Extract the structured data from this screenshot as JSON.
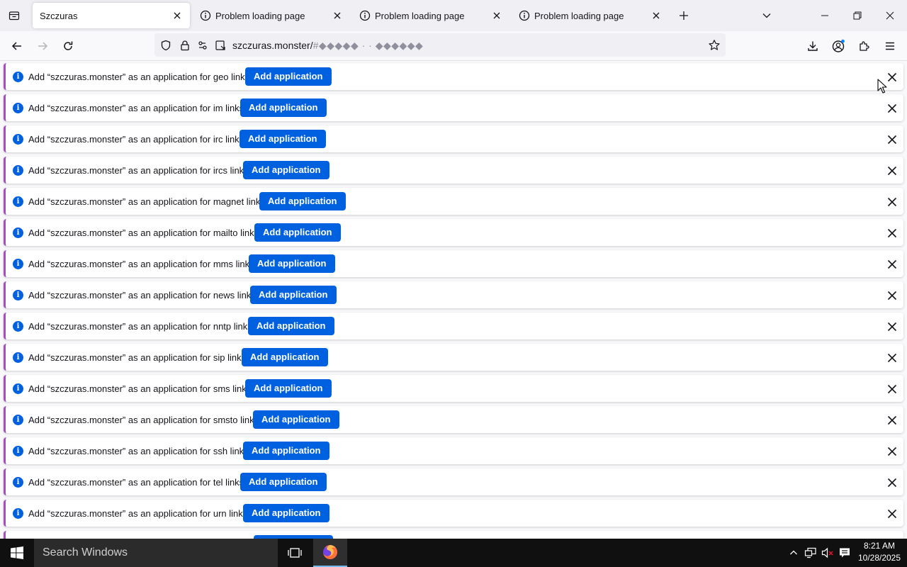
{
  "tabs": [
    {
      "title": "Szczuras",
      "active": true
    },
    {
      "title": "Problem loading page",
      "active": false
    },
    {
      "title": "Problem loading page",
      "active": false
    },
    {
      "title": "Problem loading page",
      "active": false
    }
  ],
  "urlbar": {
    "domain": "szczuras.monster/",
    "hash": "#◆◆◆◆◆ · · ◆◆◆◆◆◆"
  },
  "notifications": [
    {
      "message": "Add “szczuras.monster” as an application for geo links?",
      "button": "Add application"
    },
    {
      "message": "Add “szczuras.monster” as an application for im links?",
      "button": "Add application"
    },
    {
      "message": "Add “szczuras.monster” as an application for irc links?",
      "button": "Add application"
    },
    {
      "message": "Add “szczuras.monster” as an application for ircs links?",
      "button": "Add application"
    },
    {
      "message": "Add “szczuras.monster” as an application for magnet links?",
      "button": "Add application"
    },
    {
      "message": "Add “szczuras.monster” as an application for mailto links?",
      "button": "Add application"
    },
    {
      "message": "Add “szczuras.monster” as an application for mms links?",
      "button": "Add application"
    },
    {
      "message": "Add “szczuras.monster” as an application for news links?",
      "button": "Add application"
    },
    {
      "message": "Add “szczuras.monster” as an application for nntp links?",
      "button": "Add application"
    },
    {
      "message": "Add “szczuras.monster” as an application for sip links?",
      "button": "Add application"
    },
    {
      "message": "Add “szczuras.monster” as an application for sms links?",
      "button": "Add application"
    },
    {
      "message": "Add “szczuras.monster” as an application for smsto links?",
      "button": "Add application"
    },
    {
      "message": "Add “szczuras.monster” as an application for ssh links?",
      "button": "Add application"
    },
    {
      "message": "Add “szczuras.monster” as an application for tel links?",
      "button": "Add application"
    },
    {
      "message": "Add “szczuras.monster” as an application for urn links?",
      "button": "Add application"
    }
  ],
  "taskbar": {
    "search_placeholder": "Search Windows",
    "time": "8:21 AM",
    "date": "10/28/2025"
  },
  "colors": {
    "accent_button": "#0061e0",
    "info_icon": "#0060df",
    "notification_border": "#a24fc2"
  }
}
